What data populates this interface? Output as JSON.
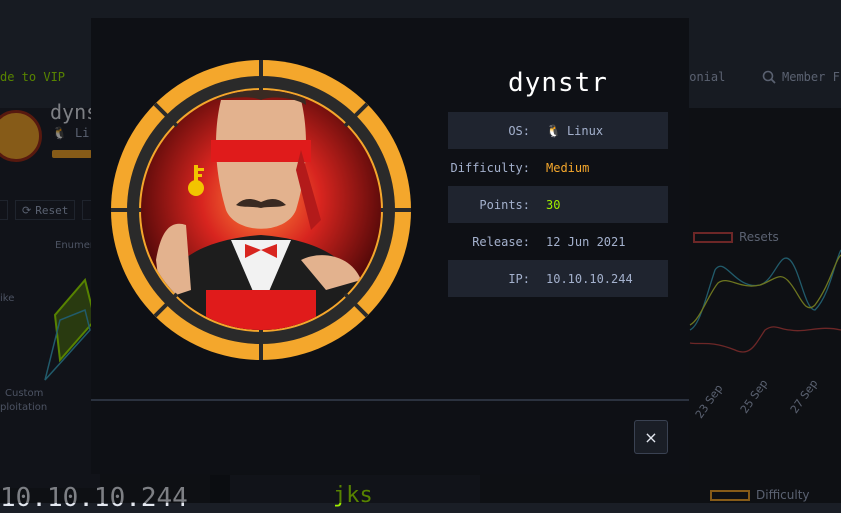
{
  "background": {
    "nav": {
      "vip_link": "de to VIP",
      "testimonial_link": "monial",
      "member_link": "Member F"
    },
    "machine": {
      "name_partial": "dyns",
      "os_partial": "Li",
      "reset_button": "Reset",
      "radar_labels": {
        "top": "Enumer",
        "left": "ike",
        "custom": "Custom",
        "exploitation": "ploitation"
      },
      "ip_large": "10.10.10.244",
      "bottom_card_text": "jks"
    },
    "chart": {
      "legend_resets": "Resets",
      "legend_difficulty": "Difficulty",
      "x_ticks": [
        "23 Sep",
        "25 Sep",
        "27 Sep"
      ]
    }
  },
  "modal": {
    "title": "dynstr",
    "rows": [
      {
        "key": "OS:",
        "value": "Linux",
        "icon": "linux-penguin-icon"
      },
      {
        "key": "Difficulty:",
        "value": "Medium"
      },
      {
        "key": "Points:",
        "value": "30"
      },
      {
        "key": "Release:",
        "value": "12 Jun 2021"
      },
      {
        "key": "IP:",
        "value": "10.10.10.244"
      }
    ],
    "close_label": "×"
  },
  "colors": {
    "accent_green": "#9fef00",
    "accent_orange": "#f4a72c",
    "modal_bg": "#0e1015",
    "row_bg": "#1f242f"
  }
}
